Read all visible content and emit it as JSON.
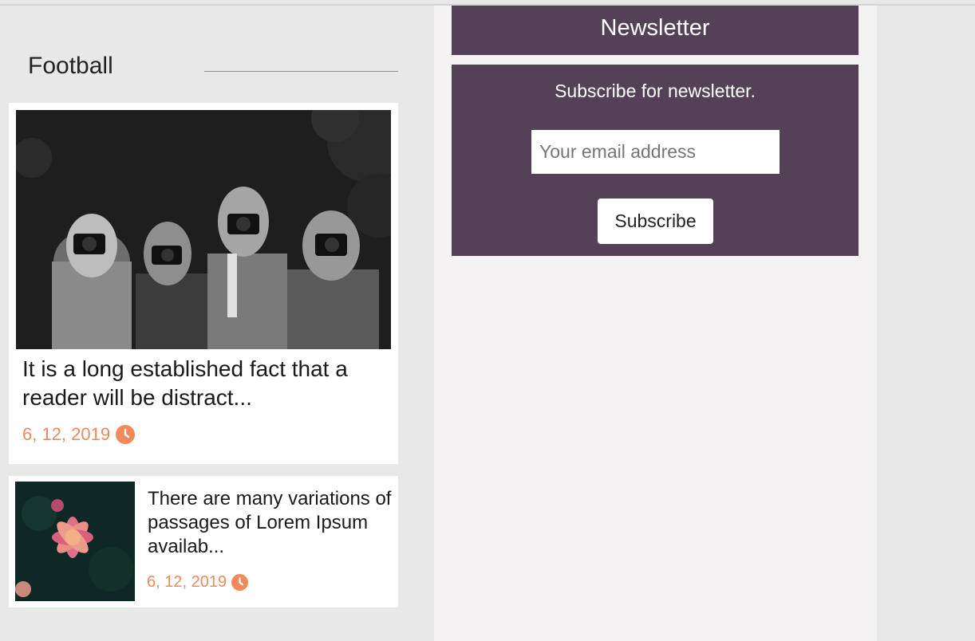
{
  "section": {
    "title": "Football"
  },
  "featured": {
    "title": "It is a long established fact that a reader will be distract...",
    "date": "6, 12, 2019",
    "image_icon": "photo-women-with-cameras"
  },
  "secondary": {
    "title": "There are many variations of passages of Lorem Ipsum availab...",
    "date": "6, 12, 2019",
    "image_icon": "photo-flower"
  },
  "newsletter": {
    "header": "Newsletter",
    "text": "Subscribe for newsletter.",
    "input_placeholder": "Your email address",
    "button_label": "Subscribe"
  },
  "colors": {
    "accent": "#f08a5d",
    "newsletter_bg": "#554157",
    "page_bg": "#e8e8e8",
    "sidebar_bg": "#f4f2f3"
  }
}
